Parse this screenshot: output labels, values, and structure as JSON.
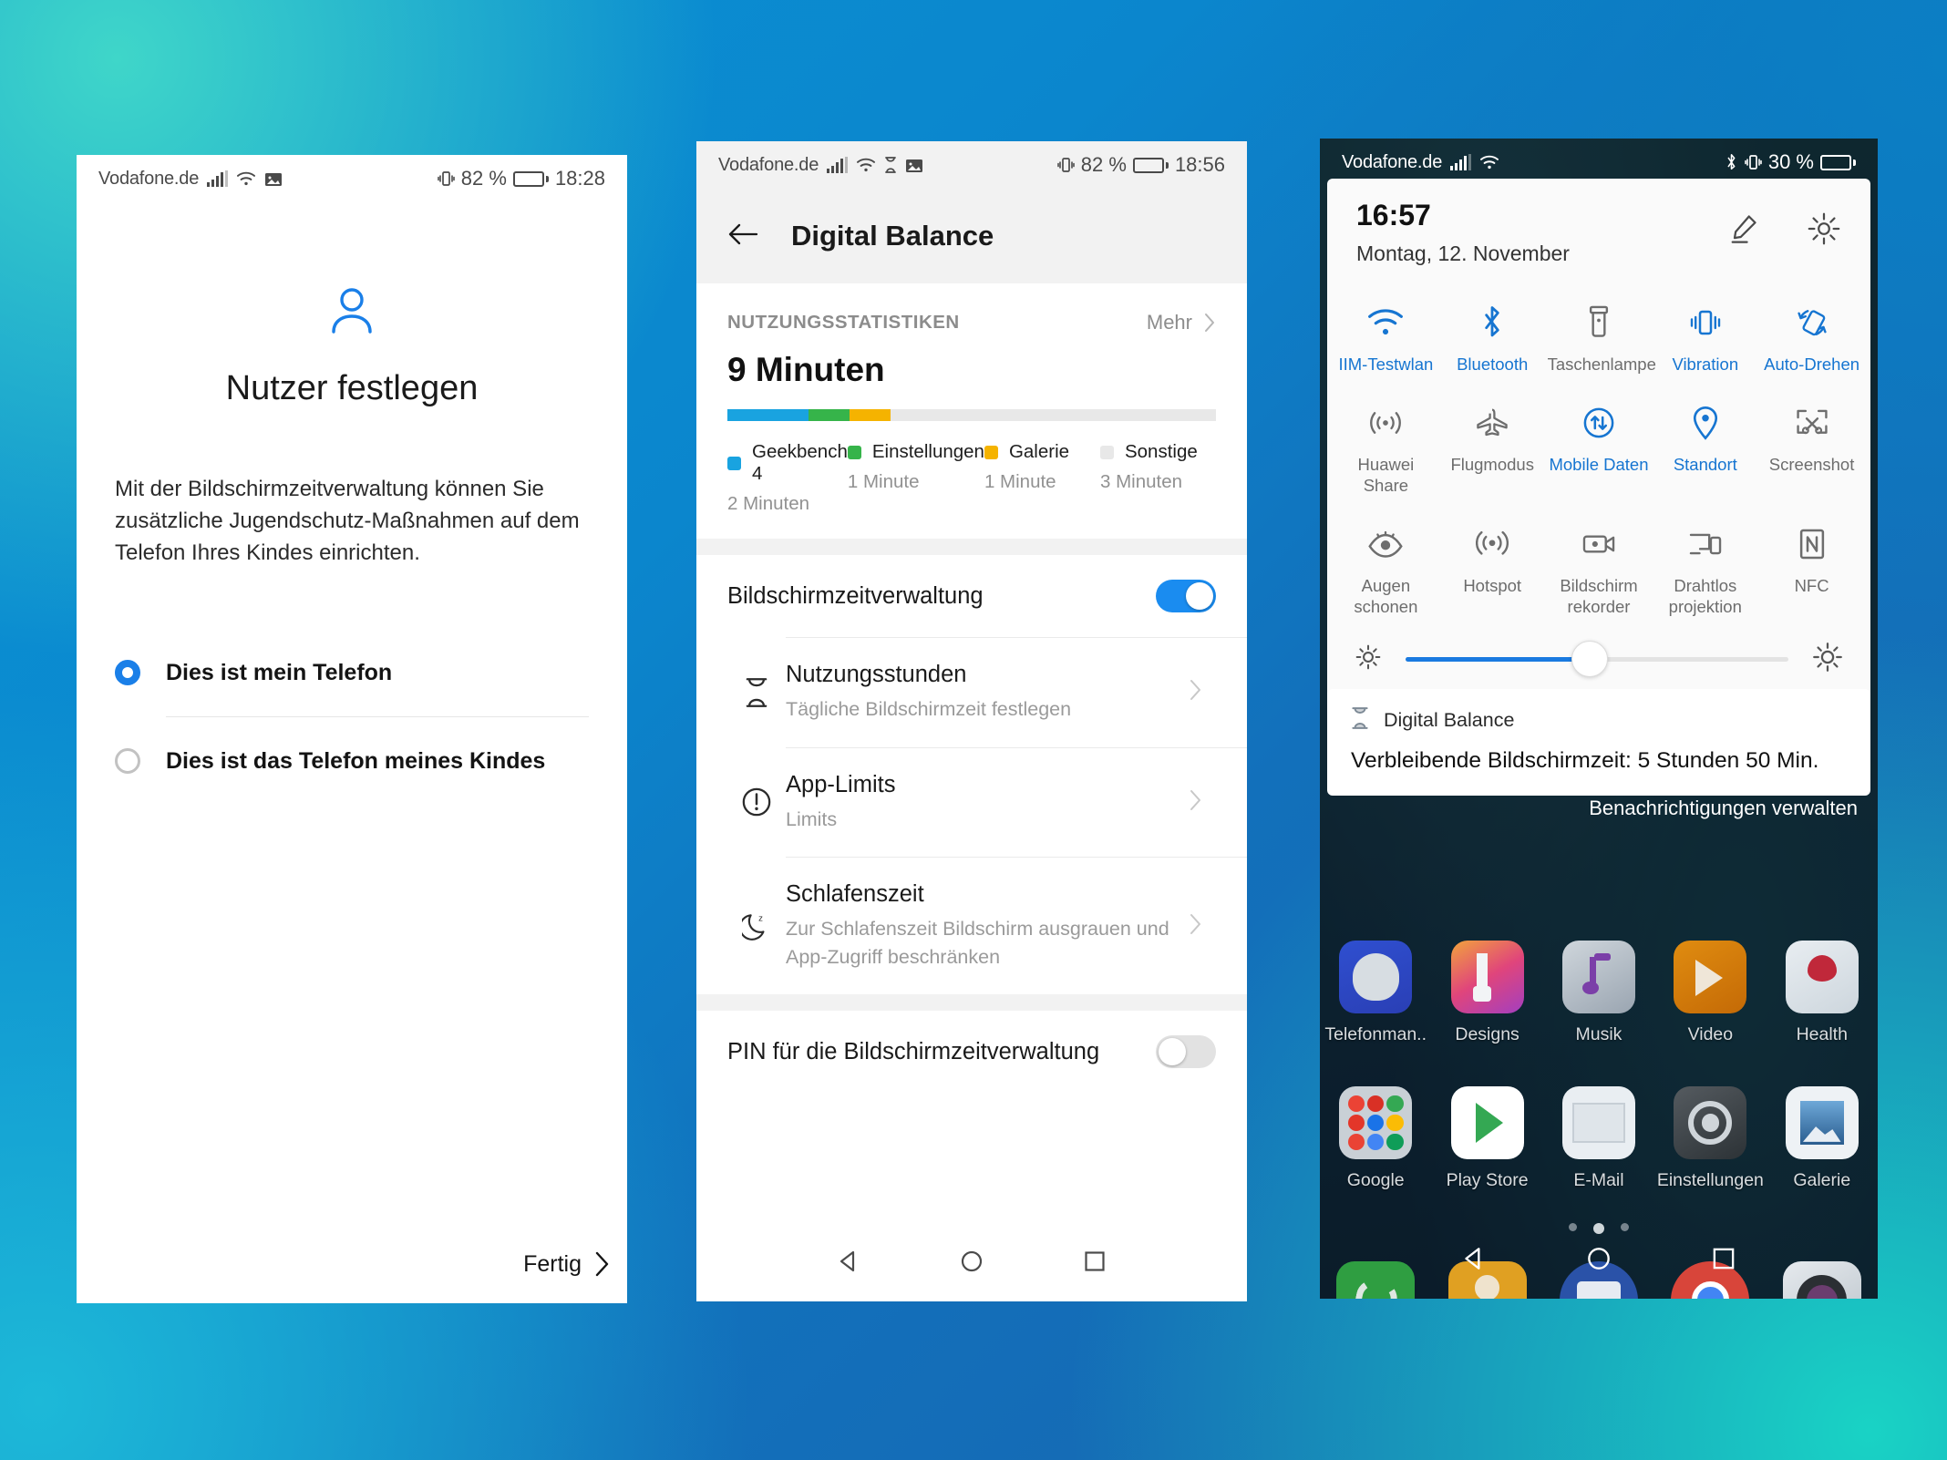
{
  "colors": {
    "accent_blue": "#1a7fe8",
    "chart_blue": "#19a3e0",
    "chart_green": "#36b44a",
    "chart_yellow": "#f5b300",
    "chart_gray": "#e8e8e8",
    "qs_on": "#1675d1",
    "qs_off": "#6d6d6d"
  },
  "phone1": {
    "statusbar": {
      "carrier": "Vodafone.de",
      "icons_left": [
        "signal-icon",
        "wifi-icon",
        "image-icon"
      ],
      "vibration": "vibrate-icon",
      "battery_percent": "82 %",
      "clock": "18:28"
    },
    "title": "Nutzer festlegen",
    "icon": "user-icon",
    "description": "Mit der Bildschirmzeitverwaltung können Sie zusätzliche Jugendschutz-Maßnahmen auf dem Telefon Ihres Kindes einrichten.",
    "options": [
      {
        "label": "Dies ist mein Telefon",
        "selected": true
      },
      {
        "label": "Dies ist das Telefon meines Kindes",
        "selected": false
      }
    ],
    "done_label": "Fertig",
    "nav": [
      "back-icon",
      "home-icon",
      "recents-icon"
    ]
  },
  "phone2": {
    "statusbar": {
      "carrier": "Vodafone.de",
      "icons_left": [
        "signal-icon",
        "wifi-icon",
        "hourglass-icon",
        "image-icon"
      ],
      "vibration": "vibrate-icon",
      "battery_percent": "82 %",
      "clock": "18:56"
    },
    "header": {
      "back": "back-arrow-icon",
      "title": "Digital Balance"
    },
    "stats": {
      "section_label": "NUTZUNGSSTATISTIKEN",
      "more_label": "Mehr",
      "total": "9 Minuten"
    },
    "chart_data": {
      "type": "bar",
      "title": "Nutzungsstatistiken",
      "subtitle": "9 Minuten",
      "categories": [
        "Geekbench 4",
        "Einstellungen",
        "Galerie",
        "Sonstige"
      ],
      "values": [
        2,
        1,
        1,
        3
      ],
      "value_labels": [
        "2 Minuten",
        "1 Minute",
        "1 Minute",
        "3 Minuten"
      ],
      "colors": [
        "#19a3e0",
        "#36b44a",
        "#f5b300",
        "#e8e8e8"
      ],
      "unit": "Minuten",
      "total": 9,
      "bar_total_capacity": 12,
      "orientation": "horizontal-stacked",
      "legend": "bottom",
      "grid": false,
      "xlabel": "",
      "ylabel": ""
    },
    "screen_time_toggle": {
      "label": "Bildschirmzeitverwaltung",
      "state": "on"
    },
    "list": [
      {
        "icon": "hourglass-icon",
        "title": "Nutzungsstunden",
        "subtitle": "Tägliche Bildschirmzeit festlegen",
        "chevron": "chevron-right-icon"
      },
      {
        "icon": "exclamation-circle-icon",
        "title": "App-Limits",
        "subtitle": "Limits",
        "chevron": "chevron-right-icon"
      },
      {
        "icon": "moon-sleep-icon",
        "title": "Schlafenszeit",
        "subtitle": "Zur Schlafenszeit Bildschirm ausgrauen und App-Zugriff beschränken",
        "chevron": "chevron-right-icon"
      }
    ],
    "pin_toggle": {
      "label": "PIN für die Bildschirmzeitverwaltung",
      "state": "off"
    },
    "nav": [
      "back-icon",
      "home-icon",
      "recents-icon"
    ]
  },
  "phone3": {
    "statusbar": {
      "carrier": "Vodafone.de",
      "icons_left": [
        "signal-icon",
        "wifi-icon"
      ],
      "bluetooth": "bluetooth-icon",
      "vibration": "vibrate-icon",
      "battery_percent": "30 %",
      "clock": ""
    },
    "quick_settings": {
      "time": "16:57",
      "date": "Montag, 12. November",
      "edit_icon": "pencil-icon",
      "settings_icon": "gear-icon",
      "tiles": [
        {
          "label": "IIM-Testwlan",
          "icon": "wifi-icon",
          "state": "on"
        },
        {
          "label": "Bluetooth",
          "icon": "bluetooth-icon",
          "state": "on"
        },
        {
          "label": "Taschenlampe",
          "icon": "flashlight-icon",
          "state": "off"
        },
        {
          "label": "Vibration",
          "icon": "vibrate-icon",
          "state": "on"
        },
        {
          "label": "Auto-Drehen",
          "icon": "auto-rotate-icon",
          "state": "on"
        },
        {
          "label": "Huawei Share",
          "icon": "huawei-share-icon",
          "state": "off"
        },
        {
          "label": "Flugmodus",
          "icon": "airplane-icon",
          "state": "off"
        },
        {
          "label": "Mobile Daten",
          "icon": "mobile-data-icon",
          "state": "on"
        },
        {
          "label": "Standort",
          "icon": "location-pin-icon",
          "state": "on"
        },
        {
          "label": "Screenshot",
          "icon": "screenshot-icon",
          "state": "off"
        },
        {
          "label": "Augen schonen",
          "icon": "eye-comfort-icon",
          "state": "off"
        },
        {
          "label": "Hotspot",
          "icon": "hotspot-icon",
          "state": "off"
        },
        {
          "label": "Bildschirm rekorder",
          "icon": "screen-recorder-icon",
          "state": "off"
        },
        {
          "label": "Drahtlos projektion",
          "icon": "cast-icon",
          "state": "off"
        },
        {
          "label": "NFC",
          "icon": "nfc-icon",
          "state": "off"
        }
      ],
      "brightness": {
        "low_icon": "brightness-low-icon",
        "high_icon": "brightness-high-icon",
        "value_percent": 48
      },
      "expand_icon": "chevron-up-icon"
    },
    "notification": {
      "icon": "hourglass-icon",
      "app": "Digital Balance",
      "text": "Verbleibende Bildschirmzeit: 5 Stunden 50 Min.",
      "manage_label": "Benachrichtigungen verwalten"
    },
    "home": {
      "row1": [
        {
          "label": "Telefonman..",
          "icon": "phone-manager-icon"
        },
        {
          "label": "Designs",
          "icon": "themes-icon"
        },
        {
          "label": "Musik",
          "icon": "music-icon"
        },
        {
          "label": "Video",
          "icon": "video-icon"
        },
        {
          "label": "Health",
          "icon": "health-icon"
        }
      ],
      "row2": [
        {
          "label": "Google",
          "icon": "google-folder-icon"
        },
        {
          "label": "Play Store",
          "icon": "play-store-icon"
        },
        {
          "label": "E-Mail",
          "icon": "email-icon"
        },
        {
          "label": "Einstellungen",
          "icon": "settings-gear-icon"
        },
        {
          "label": "Galerie",
          "icon": "gallery-icon"
        }
      ],
      "page_dots": 3,
      "active_dot": 2,
      "dock": [
        {
          "label": "phone",
          "icon": "phone-icon"
        },
        {
          "label": "contacts",
          "icon": "contacts-icon"
        },
        {
          "label": "messages",
          "icon": "messages-icon"
        },
        {
          "label": "chrome",
          "icon": "chrome-icon"
        },
        {
          "label": "camera",
          "icon": "camera-icon"
        }
      ]
    },
    "nav": [
      "back-icon",
      "home-icon",
      "recents-icon"
    ]
  }
}
